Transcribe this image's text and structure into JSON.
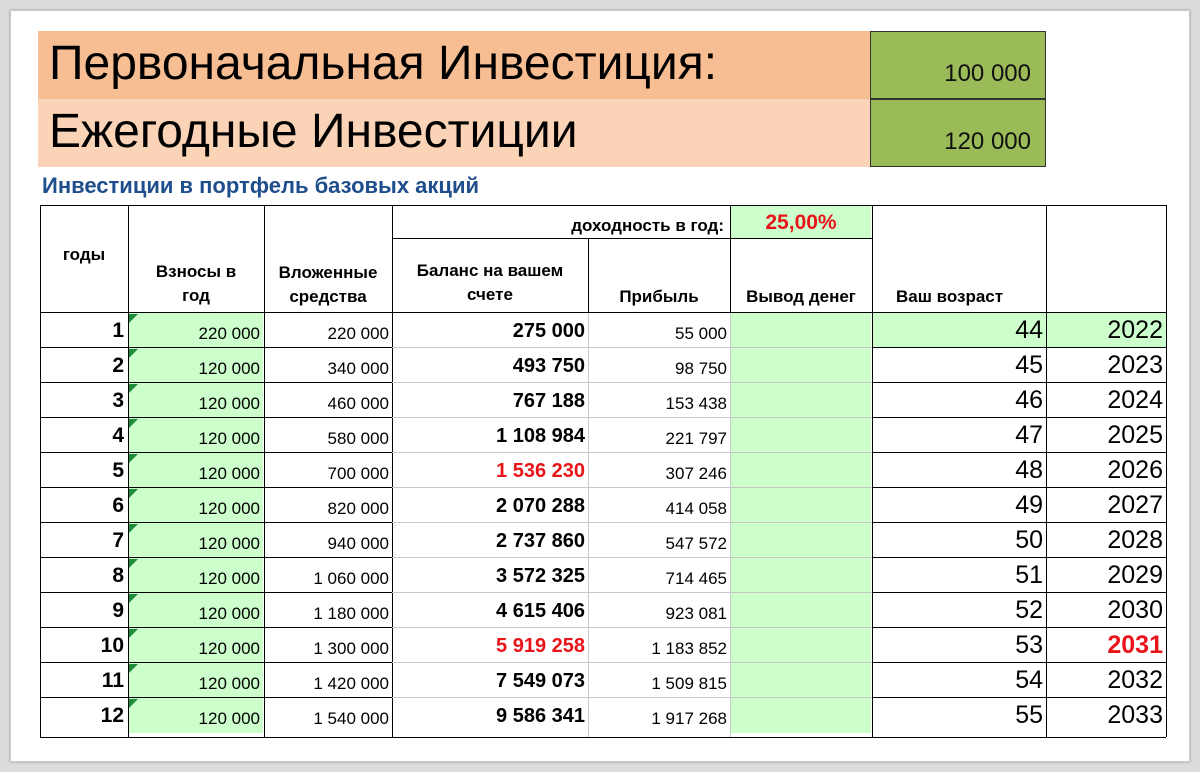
{
  "banner": {
    "initial_label": "Первоначальная Инвестиция:",
    "initial_value": "100 000",
    "annual_label": "Ежегодные Инвестиции",
    "annual_value": "120 000"
  },
  "subtitle": "Инвестиции в портфель базовых акций",
  "yield": {
    "label": "доходность в год:",
    "value": "25,00%"
  },
  "headers": {
    "years": "годы",
    "contrib": [
      "Взносы в",
      "год"
    ],
    "invested": [
      "Вложенные",
      "средства"
    ],
    "balance": [
      "Баланс на вашем",
      "счете"
    ],
    "profit": "Прибыль",
    "withdraw": "Вывод денег",
    "age": "Ваш возраст"
  },
  "rows": [
    {
      "n": "1",
      "contrib": "220 000",
      "invested": "220 000",
      "balance": "275 000",
      "profit": "55 000",
      "age": "44",
      "year": "2022"
    },
    {
      "n": "2",
      "contrib": "120 000",
      "invested": "340 000",
      "balance": "493 750",
      "profit": "98 750",
      "age": "45",
      "year": "2023"
    },
    {
      "n": "3",
      "contrib": "120 000",
      "invested": "460 000",
      "balance": "767 188",
      "profit": "153 438",
      "age": "46",
      "year": "2024"
    },
    {
      "n": "4",
      "contrib": "120 000",
      "invested": "580 000",
      "balance": "1 108 984",
      "profit": "221 797",
      "age": "47",
      "year": "2025"
    },
    {
      "n": "5",
      "contrib": "120 000",
      "invested": "700 000",
      "balance": "1 536 230",
      "profit": "307 246",
      "age": "48",
      "year": "2026"
    },
    {
      "n": "6",
      "contrib": "120 000",
      "invested": "820 000",
      "balance": "2 070 288",
      "profit": "414 058",
      "age": "49",
      "year": "2027"
    },
    {
      "n": "7",
      "contrib": "120 000",
      "invested": "940 000",
      "balance": "2 737 860",
      "profit": "547 572",
      "age": "50",
      "year": "2028"
    },
    {
      "n": "8",
      "contrib": "120 000",
      "invested": "1 060 000",
      "balance": "3 572 325",
      "profit": "714 465",
      "age": "51",
      "year": "2029"
    },
    {
      "n": "9",
      "contrib": "120 000",
      "invested": "1 180 000",
      "balance": "4 615 406",
      "profit": "923 081",
      "age": "52",
      "year": "2030"
    },
    {
      "n": "10",
      "contrib": "120 000",
      "invested": "1 300 000",
      "balance": "5 919 258",
      "profit": "1 183 852",
      "age": "53",
      "year": "2031"
    },
    {
      "n": "11",
      "contrib": "120 000",
      "invested": "1 420 000",
      "balance": "7 549 073",
      "profit": "1 509 815",
      "age": "54",
      "year": "2032"
    },
    {
      "n": "12",
      "contrib": "120 000",
      "invested": "1 540 000",
      "balance": "9 586 341",
      "profit": "1 917 268",
      "age": "55",
      "year": "2033"
    }
  ],
  "highlight_balance_rows": [
    5,
    10
  ],
  "highlight_year_rows": [
    10
  ],
  "colors": {
    "banner1": "#f7bd93",
    "banner2": "#fbd3b6",
    "green_box": "#9bbb59",
    "light_green": "#ccffcc",
    "red": "#e8141a",
    "subtitle": "#1f4e8c"
  }
}
